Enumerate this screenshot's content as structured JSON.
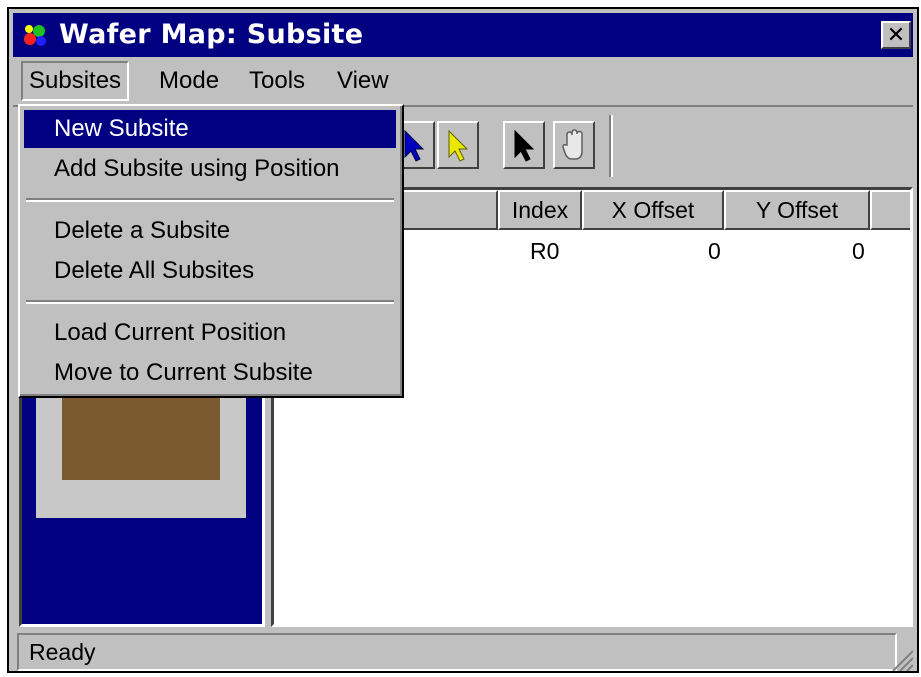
{
  "window": {
    "title": "Wafer Map: Subsite",
    "close_label": "✕"
  },
  "menubar": {
    "items": [
      {
        "label": "Subsites",
        "open": true
      },
      {
        "label": "Mode"
      },
      {
        "label": "Tools"
      },
      {
        "label": "View"
      }
    ]
  },
  "subsites_menu": {
    "items": [
      {
        "label": "New Subsite",
        "highlighted": true
      },
      {
        "label": "Add Subsite using Position"
      },
      {
        "label": "Delete a Subsite"
      },
      {
        "label": "Delete All Subsites"
      },
      {
        "label": "Load Current Position"
      },
      {
        "label": "Move to Current Subsite"
      }
    ]
  },
  "toolbar": {
    "buttons": [
      {
        "icon": "blue-arrow-icon"
      },
      {
        "icon": "yellow-arrow-icon"
      },
      {
        "icon": "black-arrow-icon"
      },
      {
        "icon": "hand-icon"
      }
    ]
  },
  "table": {
    "columns": [
      "Index",
      "X Offset",
      "Y Offset"
    ],
    "rows": [
      {
        "index": "R0",
        "x_offset": "0",
        "y_offset": "0"
      }
    ]
  },
  "status": {
    "text": "Ready"
  },
  "colors": {
    "title_bar": "#000080",
    "face": "#c0c0c0",
    "die": "#7a5a2e",
    "crosshair": "#ff0000"
  }
}
